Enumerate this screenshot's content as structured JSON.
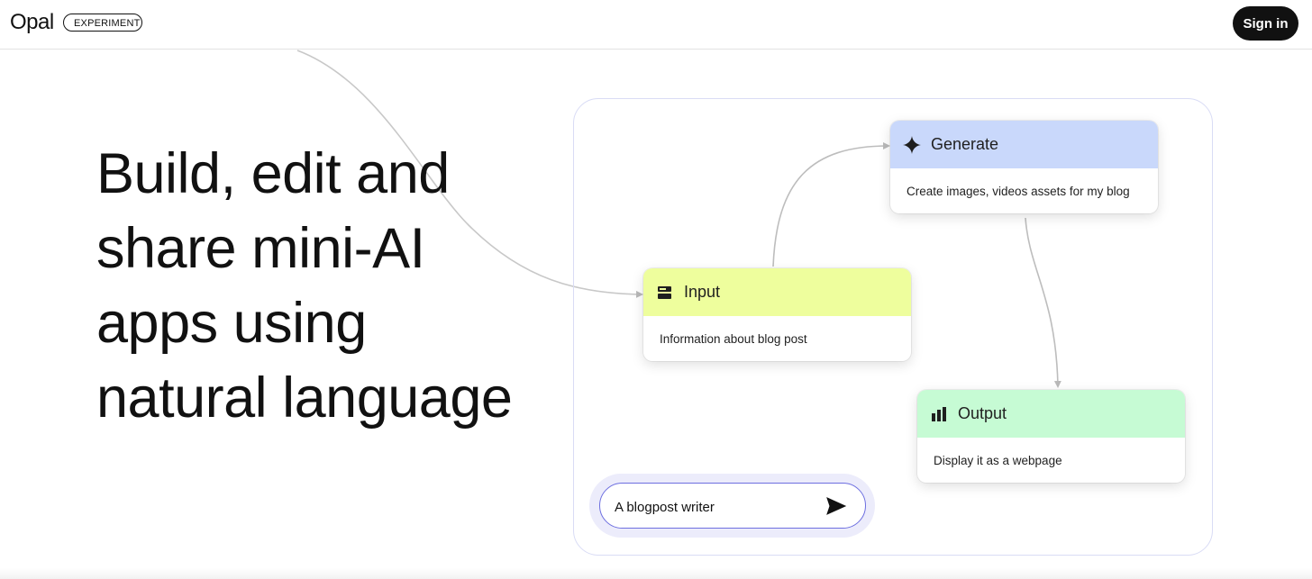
{
  "header": {
    "logo": "Opal",
    "badge": "EXPERIMENT",
    "sign_in": "Sign in"
  },
  "hero": {
    "lines": [
      "Build, edit and",
      "share mini-AI",
      "apps using",
      "natural language"
    ]
  },
  "nodes": {
    "generate": {
      "title": "Generate",
      "description": "Create images, videos assets for my blog",
      "icon": "sparkle-icon",
      "color": "#c9d8fb"
    },
    "input": {
      "title": "Input",
      "description": "Information about blog post",
      "icon": "input-icon",
      "color": "#eefe9d"
    },
    "output": {
      "title": "Output",
      "description": "Display it as a webpage",
      "icon": "output-icon",
      "color": "#c6fbd4"
    }
  },
  "prompt": {
    "value": "A blogpost writer",
    "send_icon": "send-icon"
  },
  "colors": {
    "accent": "#6d6fe0",
    "button": "#111111"
  }
}
